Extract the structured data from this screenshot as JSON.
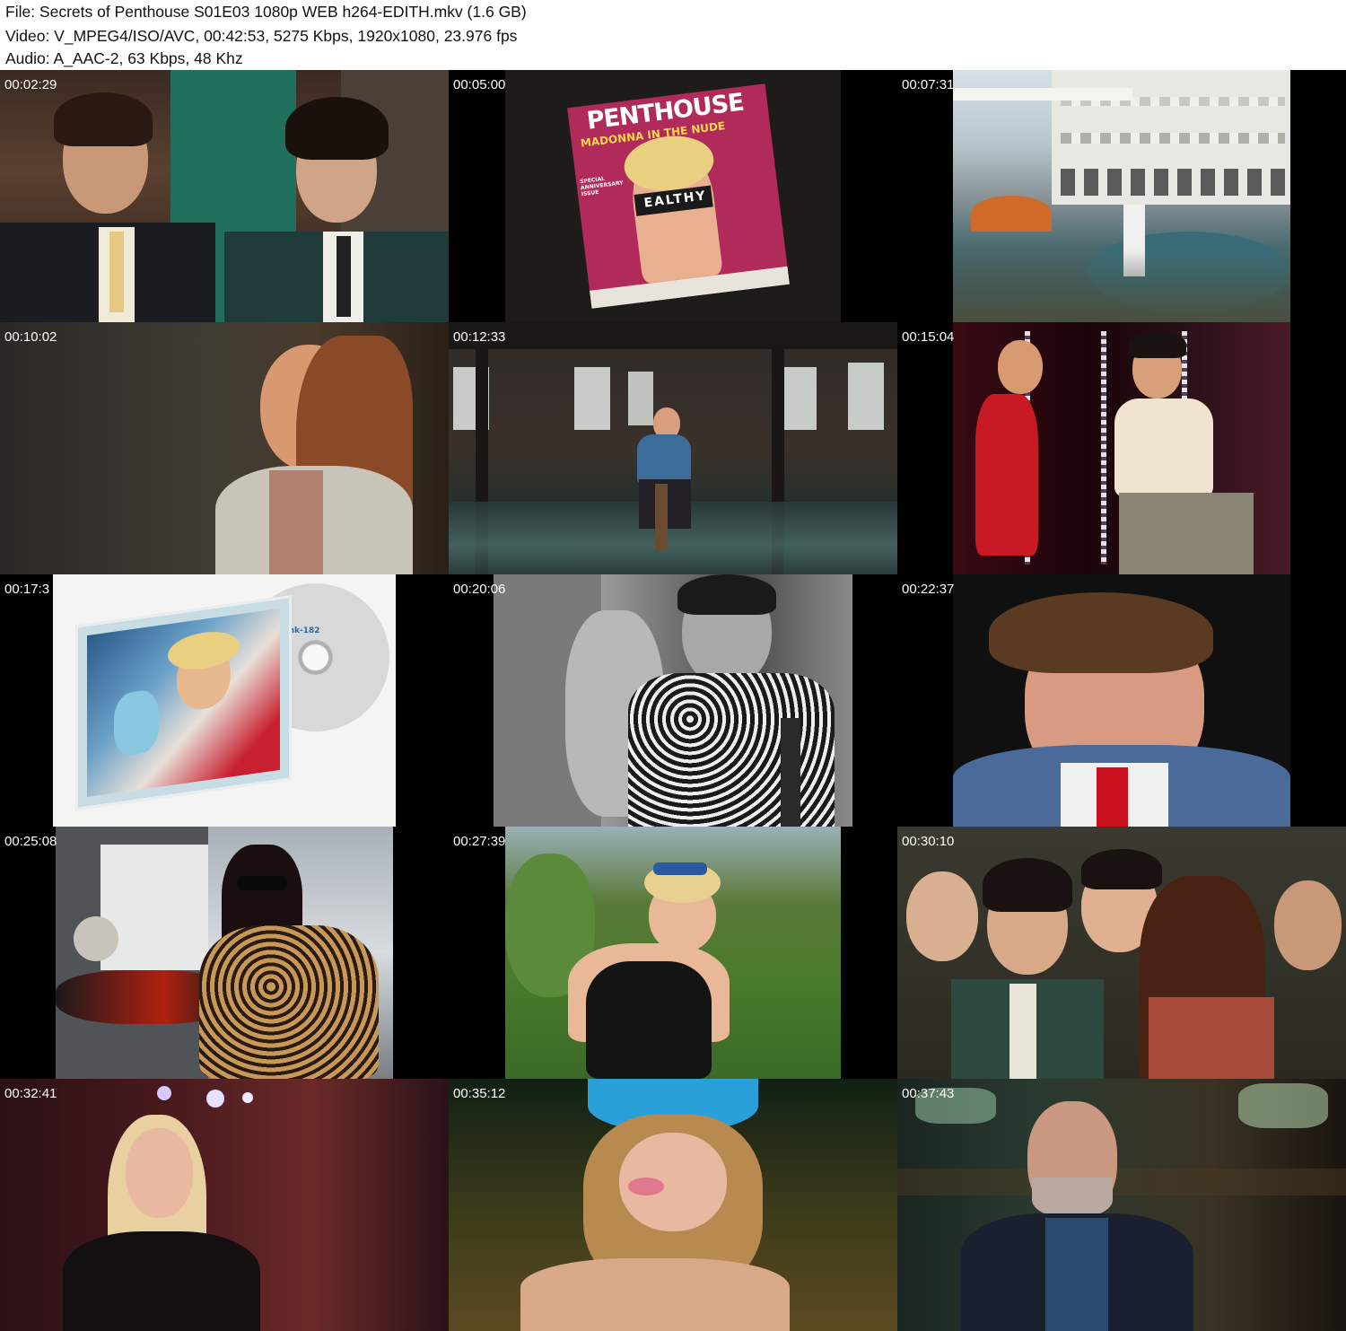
{
  "header": {
    "file_line": "File: Secrets of Penthouse S01E03 1080p WEB h264-EDITH.mkv (1.6 GB)",
    "video_line": "Video: V_MPEG4/ISO/AVC, 00:42:53, 5275 Kbps, 1920x1080, 23.976 fps",
    "audio_line": "Audio: A_AAC-2, 63 Kbps, 48 Khz"
  },
  "thumbnails": [
    {
      "timestamp": "00:02:29",
      "scene": "two-young-men-in-suits"
    },
    {
      "timestamp": "00:05:00",
      "scene": "penthouse-magazine-cover",
      "magazine_title": "PENTHOUSE",
      "headline": "MADONNA IN THE NUDE",
      "corner_text": "SPECIAL ANNIVERSARY ISSUE",
      "shirt_text": "EALTHY"
    },
    {
      "timestamp": "00:07:31",
      "scene": "resort-pool-building"
    },
    {
      "timestamp": "00:10:02",
      "scene": "woman-profile-interview"
    },
    {
      "timestamp": "00:12:33",
      "scene": "man-seated-warehouse"
    },
    {
      "timestamp": "00:15:04",
      "scene": "couple-red-stage"
    },
    {
      "timestamp": "00:17:3",
      "scene": "cd-case-album",
      "disc_text": "blink-182"
    },
    {
      "timestamp": "00:20:06",
      "scene": "bw-man-statue"
    },
    {
      "timestamp": "00:22:37",
      "scene": "man-denim-jacket"
    },
    {
      "timestamp": "00:25:08",
      "scene": "woman-leopard-coat"
    },
    {
      "timestamp": "00:27:39",
      "scene": "woman-swimsuit-grass"
    },
    {
      "timestamp": "00:30:10",
      "scene": "group-photo-vintage"
    },
    {
      "timestamp": "00:32:41",
      "scene": "blonde-woman-interview"
    },
    {
      "timestamp": "00:35:12",
      "scene": "girl-blue-cap"
    },
    {
      "timestamp": "00:37:43",
      "scene": "man-bar-interview"
    }
  ],
  "colors": {
    "header_bg": "#ffffff",
    "grid_bg": "#000000",
    "timestamp_text": "#ffffff"
  }
}
